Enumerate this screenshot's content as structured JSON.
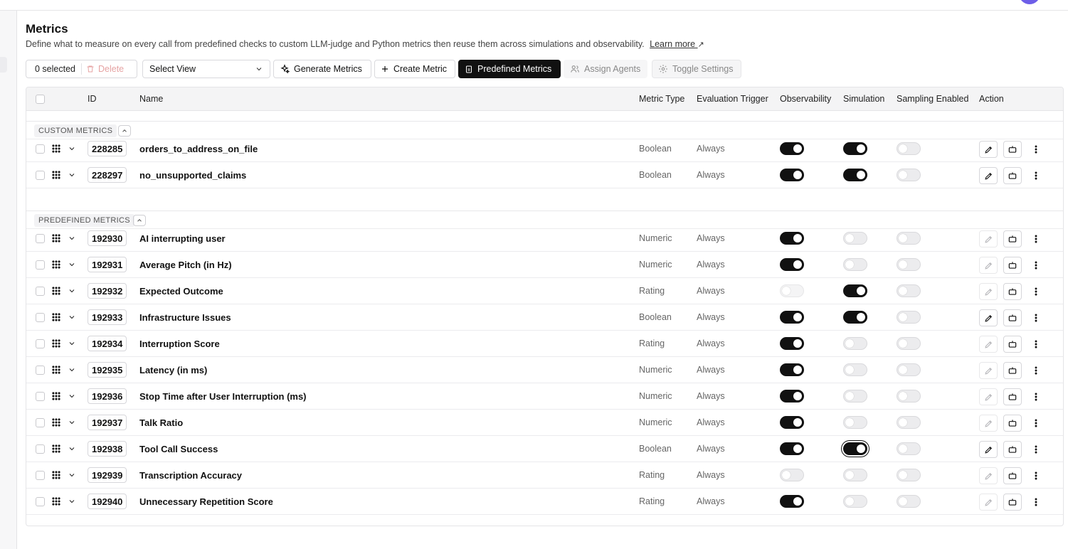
{
  "page": {
    "title": "Metrics",
    "description": "Define what to measure on every call from predefined checks to custom LLM-judge and Python metrics then reuse them across simulations and observability.",
    "learn_more": "Learn more"
  },
  "toolbar": {
    "selected_count": "0 selected",
    "delete_label": "Delete",
    "select_view_placeholder": "Select View",
    "generate_label": "Generate Metrics",
    "create_label": "Create Metric",
    "predefined_label": "Predefined Metrics",
    "assign_label": "Assign Agents",
    "toggle_label": "Toggle Settings"
  },
  "table": {
    "columns": {
      "id": "ID",
      "name": "Name",
      "metric_type": "Metric Type",
      "trigger": "Evaluation Trigger",
      "observability": "Observability",
      "simulation": "Simulation",
      "sampling": "Sampling Enabled",
      "action": "Action"
    },
    "sections": [
      {
        "label": "CUSTOM METRICS",
        "rows": [
          {
            "id": "228285",
            "name": "orders_to_address_on_file",
            "type": "Boolean",
            "trigger": "Always",
            "obs": true,
            "sim": true,
            "sampling": false,
            "editable": true
          },
          {
            "id": "228297",
            "name": "no_unsupported_claims",
            "type": "Boolean",
            "trigger": "Always",
            "obs": true,
            "sim": true,
            "sampling": false,
            "editable": true
          }
        ]
      },
      {
        "label": "PREDEFINED METRICS",
        "rows": [
          {
            "id": "192930",
            "name": "AI interrupting user",
            "type": "Numeric",
            "trigger": "Always",
            "obs": true,
            "sim": false,
            "sampling": false,
            "editable": false
          },
          {
            "id": "192931",
            "name": "Average Pitch (in Hz)",
            "type": "Numeric",
            "trigger": "Always",
            "obs": true,
            "sim": false,
            "sampling": false,
            "editable": false
          },
          {
            "id": "192932",
            "name": "Expected Outcome",
            "type": "Rating",
            "trigger": "Always",
            "obs": false,
            "sim": true,
            "sampling": false,
            "editable": false,
            "obs_dim": true
          },
          {
            "id": "192933",
            "name": "Infrastructure Issues",
            "type": "Boolean",
            "trigger": "Always",
            "obs": true,
            "sim": true,
            "sampling": false,
            "editable": true
          },
          {
            "id": "192934",
            "name": "Interruption Score",
            "type": "Rating",
            "trigger": "Always",
            "obs": true,
            "sim": false,
            "sampling": false,
            "editable": false
          },
          {
            "id": "192935",
            "name": "Latency (in ms)",
            "type": "Numeric",
            "trigger": "Always",
            "obs": true,
            "sim": false,
            "sampling": false,
            "editable": false
          },
          {
            "id": "192936",
            "name": "Stop Time after User Interruption (ms)",
            "type": "Numeric",
            "trigger": "Always",
            "obs": true,
            "sim": false,
            "sampling": false,
            "editable": false
          },
          {
            "id": "192937",
            "name": "Talk Ratio",
            "type": "Numeric",
            "trigger": "Always",
            "obs": true,
            "sim": false,
            "sampling": false,
            "editable": false
          },
          {
            "id": "192938",
            "name": "Tool Call Success",
            "type": "Boolean",
            "trigger": "Always",
            "obs": true,
            "sim": true,
            "sampling": false,
            "editable": true,
            "sim_focus": true
          },
          {
            "id": "192939",
            "name": "Transcription Accuracy",
            "type": "Rating",
            "trigger": "Always",
            "obs": false,
            "sim": false,
            "sampling": false,
            "editable": false
          },
          {
            "id": "192940",
            "name": "Unnecessary Repetition Score",
            "type": "Rating",
            "trigger": "Always",
            "obs": true,
            "sim": false,
            "sampling": false,
            "editable": false
          }
        ]
      }
    ]
  }
}
